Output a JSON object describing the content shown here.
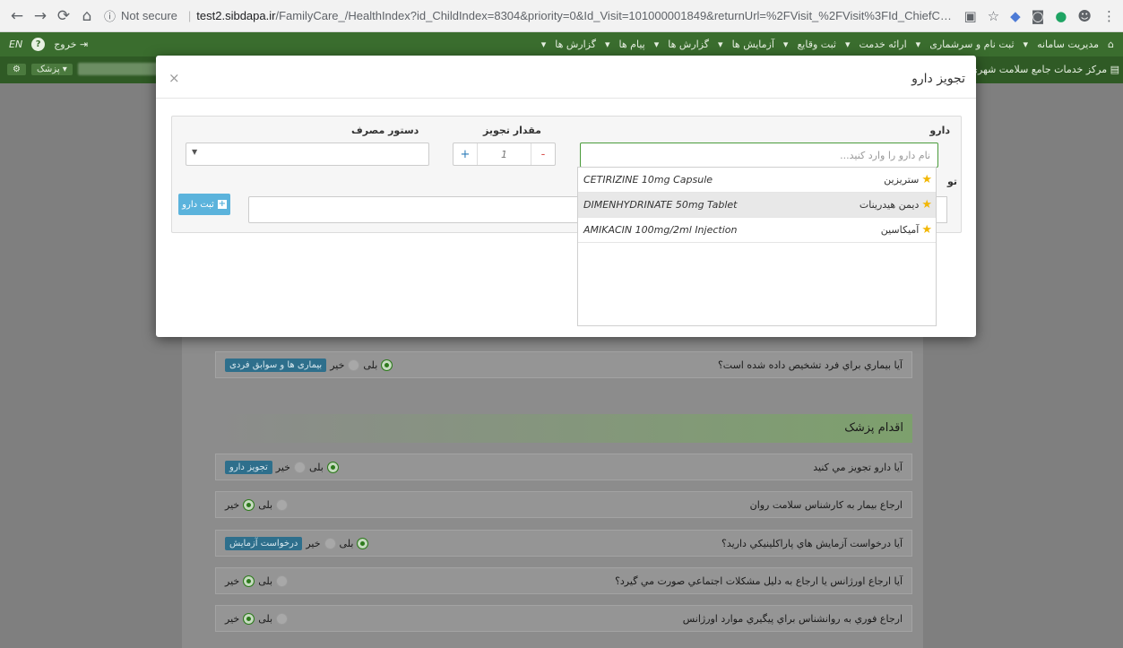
{
  "browser": {
    "security": "Not secure",
    "host": "test2.sibdapa.ir",
    "path": "/FamilyCare_/HealthIndex?id_ChildIndex=8304&priority=0&Id_Visit=101000001849&returnUrl=%2FVisit_%2FVisit%3FId_ChiefCompl..."
  },
  "app_nav": {
    "menu": [
      "مدیریت سامانه",
      "ثبت نام و سرشماری",
      "ارائه خدمت",
      "ثبت وقایع",
      "آزمایش ها",
      "گزارش ها",
      "پیام ها",
      "گزارش ها"
    ],
    "logout": "خروج",
    "lang": "EN",
    "help": "?"
  },
  "sub_bar": {
    "center": "مرکز خدمات جامع سلامت شهری",
    "user_role": "پزشک"
  },
  "modal": {
    "title": "تجویز دارو",
    "close": "×",
    "drug_label": "دارو",
    "drug_placeholder": "نام دارو را وارد کنید...",
    "qty_label": "مقدار تجویز",
    "qty_value": "1",
    "plus": "+",
    "minus": "-",
    "usage_label": "دستور مصرف",
    "usage_caret": "▼",
    "save_label": "ثبت دارو",
    "truncated_label": "تو"
  },
  "dropdown": {
    "items": [
      {
        "en": "CETIRIZINE 10mg Capsule",
        "fa": "ستریزین"
      },
      {
        "en": "DIMENHYDRINATE 50mg Tablet",
        "fa": "دیمن هیدرینات"
      },
      {
        "en": "AMIKACIN 100mg/2ml Injection",
        "fa": "آمیکاسین"
      }
    ]
  },
  "questions": [
    {
      "text": "آیا بیماري براي فرد تشخیص داده شده است؟",
      "yes": "بلی",
      "no": "خیر",
      "selected": "yes",
      "button": "بیماری ها و سوابق فردی"
    },
    {
      "text": "آیا دارو تجویز مي کنید",
      "yes": "بلی",
      "no": "خیر",
      "selected": "yes",
      "button": "تجویز دارو"
    },
    {
      "text": "ارجاع بیمار به کارشناس سلامت روان",
      "yes": "بلی",
      "no": "خیر",
      "selected": "no",
      "button": ""
    },
    {
      "text": "آیا درخواست آزمایش هاي پاراکلینیکي دارید؟",
      "yes": "بلی",
      "no": "خیر",
      "selected": "yes",
      "button": "درخواست آزمایش"
    },
    {
      "text": "آیا ارجاع اورژانس یا ارجاع به دلیل مشکلات اجتماعي صورت مي گیرد؟",
      "yes": "بلی",
      "no": "خیر",
      "selected": "no",
      "button": ""
    },
    {
      "text": "ارجاع فوري به روانشناس براي پیگیري موارد اورژانس",
      "yes": "بلی",
      "no": "خیر",
      "selected": "no",
      "button": ""
    }
  ],
  "section": {
    "title": "اقدام پزشک"
  }
}
